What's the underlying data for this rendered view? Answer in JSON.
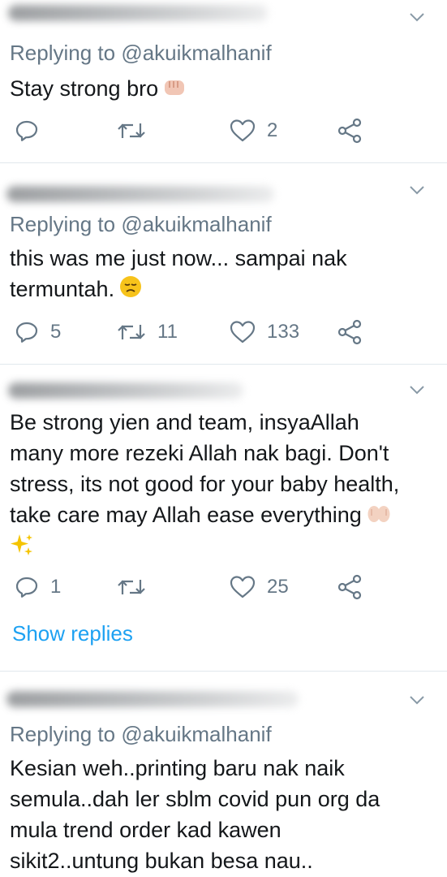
{
  "tweets": [
    {
      "reply_prefix": "Replying to ",
      "reply_handle": "@akuikmalhanif",
      "lines": [
        "Stay strong bro"
      ],
      "emoji": "fist-emoji",
      "actions": {
        "reply": "",
        "retweet": "",
        "like": "2"
      }
    },
    {
      "reply_prefix": "Replying to ",
      "reply_handle": "@akuikmalhanif",
      "lines": [
        "this was me just now... sampai nak",
        "termuntah."
      ],
      "emoji": "disappointed-face-emoji",
      "actions": {
        "reply": "5",
        "retweet": "11",
        "like": "133"
      }
    },
    {
      "lines": [
        "Be strong yien and team, insyaAllah",
        "many more rezeki Allah nak bagi. Don't",
        "stress, its not good for your baby health,",
        "take care may Allah ease everything"
      ],
      "emoji": "hands-emoji",
      "emoji2": "sparkles-emoji",
      "actions": {
        "reply": "1",
        "retweet": "",
        "like": "25"
      },
      "show_replies": "Show replies"
    },
    {
      "reply_prefix": "Replying to ",
      "reply_handle": "@akuikmalhanif",
      "lines": [
        "Kesian weh..printing baru nak naik",
        "semula..dah ler sblm covid pun org da",
        "mula trend order kad kawen",
        "sikit2..untung bukan besa nau.."
      ]
    }
  ],
  "colors": {
    "text": "#14171a",
    "muted": "#657786",
    "accent": "#1da1f2",
    "divider": "#e1e8ed"
  }
}
